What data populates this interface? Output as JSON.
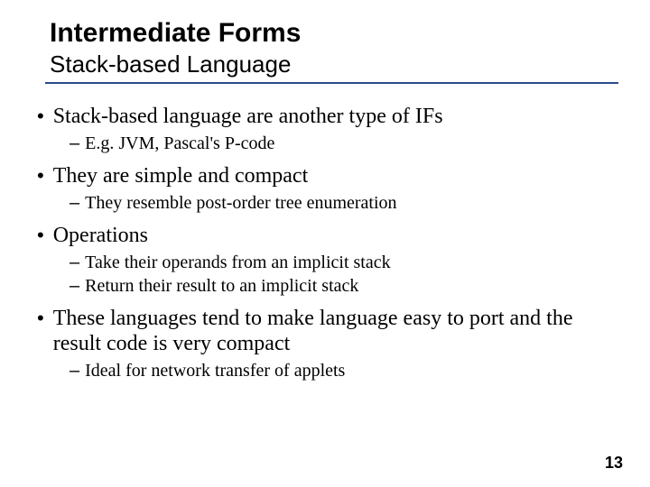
{
  "title": "Intermediate Forms",
  "subtitle": "Stack-based Language",
  "bullets": [
    {
      "text": "Stack-based language are another type of IFs",
      "subs": [
        "E.g. JVM, Pascal's P-code"
      ]
    },
    {
      "text": "They are simple and compact",
      "subs": [
        "They resemble post-order tree enumeration"
      ]
    },
    {
      "text": "Operations",
      "subs": [
        "Take their operands from an implicit stack",
        "Return their result to an implicit stack"
      ]
    },
    {
      "text": "These languages tend to make language easy to port and the result code is very compact",
      "subs": [
        "Ideal for network transfer of applets"
      ]
    }
  ],
  "pageNumber": "13"
}
